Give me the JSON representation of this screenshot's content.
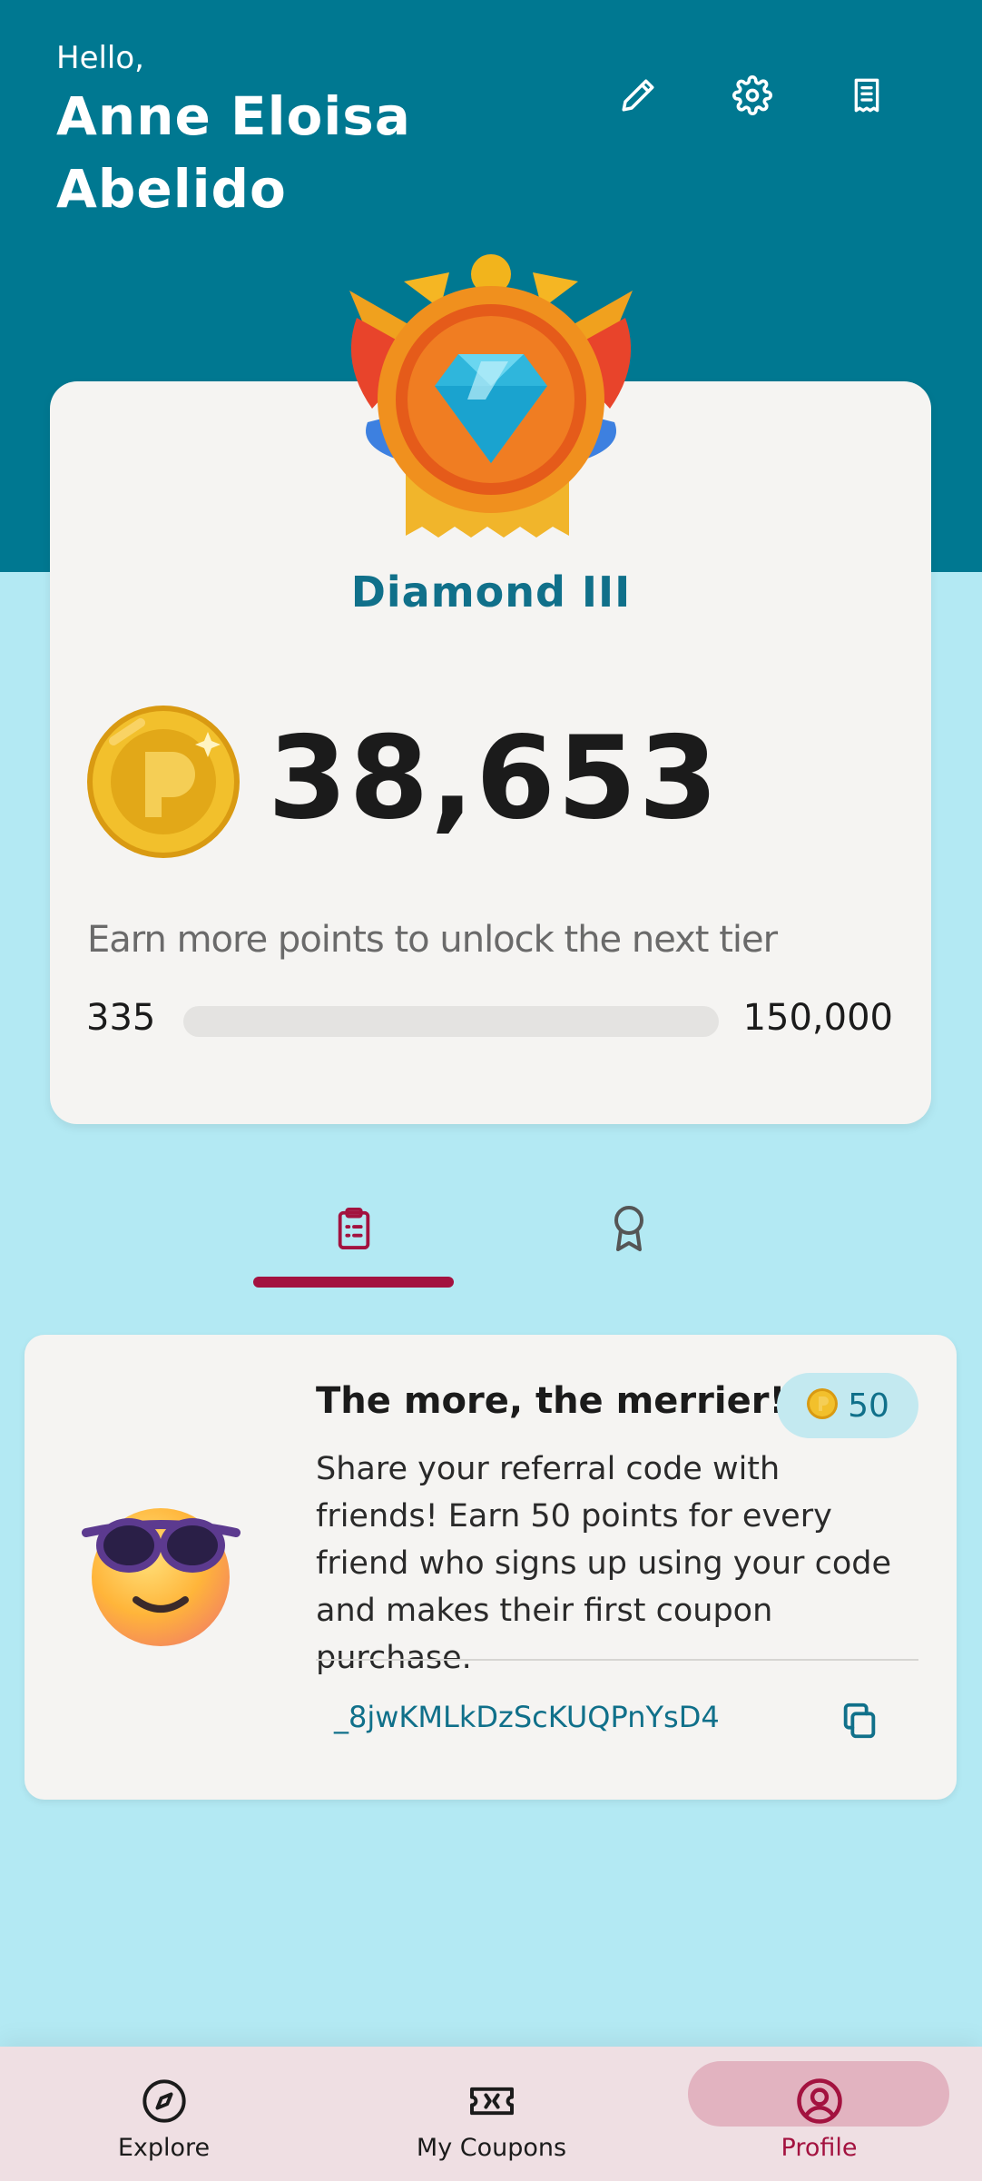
{
  "header": {
    "greeting": "Hello,",
    "user_name": "Anne Eloisa Abelido",
    "icons": [
      "edit-icon",
      "settings-icon",
      "receipt-icon"
    ]
  },
  "tier": {
    "name": "Diamond III",
    "points": "38,653",
    "hint": "Earn more points to unlock the next tier",
    "progress_min": "335",
    "progress_max": "150,000",
    "progress_fill_fraction": 0.0
  },
  "tabs": [
    {
      "icon": "clipboard-list-icon",
      "active": true
    },
    {
      "icon": "award-ribbon-icon",
      "active": false
    }
  ],
  "referral": {
    "title": "The more, the merrier!",
    "points_badge": "50",
    "body": "Share your referral code with friends! Earn 50 points for every friend who signs up using your code and makes their first coupon purchase.",
    "code": "_8jwKMLkDzScKUQPnYsD4"
  },
  "nav": {
    "items": [
      {
        "label": "Explore",
        "icon": "compass-icon",
        "active": false
      },
      {
        "label": "My Coupons",
        "icon": "ticket-icon",
        "active": false
      },
      {
        "label": "Profile",
        "icon": "user-circle-icon",
        "active": true
      }
    ]
  },
  "colors": {
    "header_bg": "#007891",
    "page_bg": "#b3e9f3",
    "card_bg": "#f5f4f2",
    "accent_teal": "#10708a",
    "accent_maroon": "#a3123f",
    "nav_bg": "#efdfe3",
    "nav_active_pill": "#e2b3c0"
  }
}
